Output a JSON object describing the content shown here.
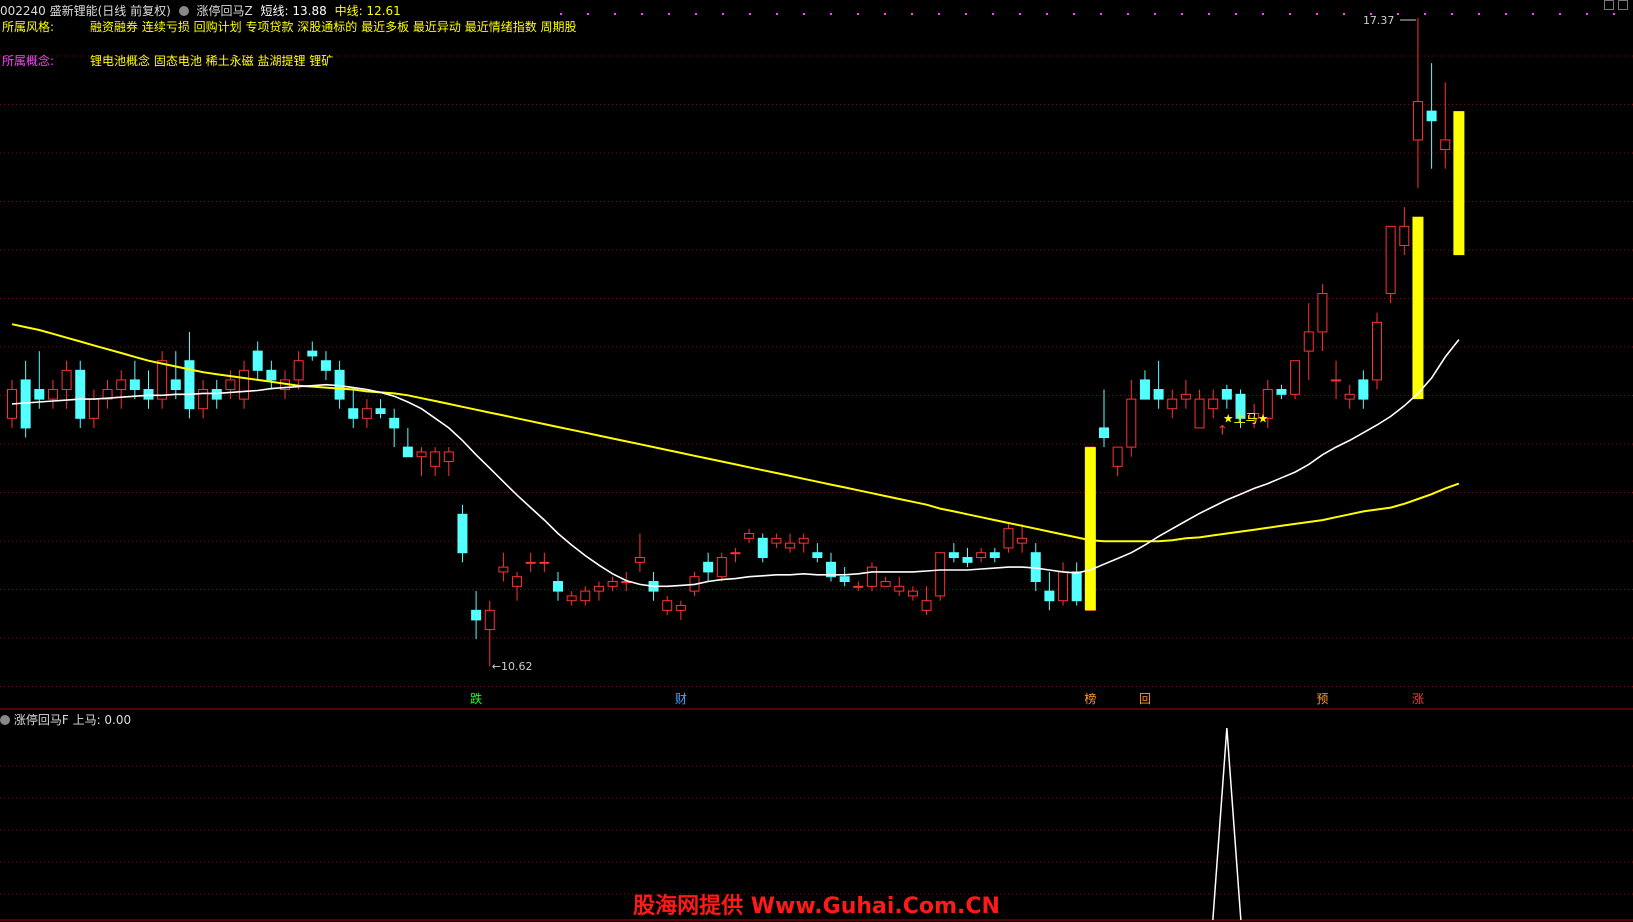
{
  "header": {
    "code_name": "002240 盛新锂能(日线 前复权)",
    "indicator": "涨停回马Z",
    "short_label": "短线: 13.88",
    "mid_label": "中线: 12.61"
  },
  "info": {
    "style_label": "所属风格:",
    "style_value": "融资融券 连续亏损 回购计划 专项贷款 深股通标的 最近多板 最近异动 最近情绪指数 周期股",
    "concept_label": "所属概念:",
    "concept_value": "锂电池概念 固态电池 稀土永磁 盐湖提锂 锂矿"
  },
  "sub_indicator": {
    "name": "涨停回马F",
    "value_label": "上马: 0.00"
  },
  "watermark": "股海网提供 Www.Guhai.Com.CN",
  "colors": {
    "up": "#ff3232",
    "down": "#54ffff",
    "short_line": "#ffffff",
    "mid_line": "#ffff00",
    "signal": "#ffff00",
    "grid": "#8b0000"
  },
  "chart_data": {
    "type": "candlestick",
    "price_min_label": "←10.62",
    "price_max_label": "17.37",
    "ohlc": [
      [
        13.2,
        13.6,
        13.1,
        13.5
      ],
      [
        13.6,
        13.8,
        13.0,
        13.1
      ],
      [
        13.5,
        13.9,
        13.3,
        13.4
      ],
      [
        13.4,
        13.6,
        13.3,
        13.5
      ],
      [
        13.5,
        13.8,
        13.3,
        13.7
      ],
      [
        13.7,
        13.8,
        13.1,
        13.2
      ],
      [
        13.2,
        13.5,
        13.1,
        13.4
      ],
      [
        13.4,
        13.6,
        13.3,
        13.5
      ],
      [
        13.5,
        13.7,
        13.3,
        13.6
      ],
      [
        13.6,
        13.8,
        13.4,
        13.5
      ],
      [
        13.5,
        13.7,
        13.3,
        13.4
      ],
      [
        13.4,
        13.9,
        13.3,
        13.8
      ],
      [
        13.6,
        13.9,
        13.4,
        13.5
      ],
      [
        13.8,
        14.1,
        13.2,
        13.3
      ],
      [
        13.3,
        13.6,
        13.2,
        13.5
      ],
      [
        13.5,
        13.6,
        13.3,
        13.4
      ],
      [
        13.5,
        13.7,
        13.4,
        13.6
      ],
      [
        13.4,
        13.8,
        13.3,
        13.7
      ],
      [
        13.9,
        14.0,
        13.6,
        13.7
      ],
      [
        13.7,
        13.8,
        13.5,
        13.6
      ],
      [
        13.5,
        13.7,
        13.4,
        13.6
      ],
      [
        13.6,
        13.9,
        13.5,
        13.8
      ],
      [
        13.9,
        14.0,
        13.8,
        13.85
      ],
      [
        13.8,
        13.9,
        13.6,
        13.7
      ],
      [
        13.7,
        13.8,
        13.3,
        13.4
      ],
      [
        13.3,
        13.5,
        13.1,
        13.2
      ],
      [
        13.2,
        13.4,
        13.1,
        13.3
      ],
      [
        13.3,
        13.4,
        13.2,
        13.25
      ],
      [
        13.2,
        13.3,
        12.9,
        13.1
      ],
      [
        12.9,
        13.1,
        12.8,
        12.8
      ],
      [
        12.8,
        12.9,
        12.6,
        12.85
      ],
      [
        12.7,
        12.9,
        12.6,
        12.85
      ],
      [
        12.75,
        12.9,
        12.6,
        12.85
      ],
      [
        12.2,
        12.3,
        11.7,
        11.8
      ],
      [
        11.2,
        11.4,
        10.9,
        11.1
      ],
      [
        11.0,
        11.3,
        10.62,
        11.2
      ],
      [
        11.6,
        11.8,
        11.5,
        11.65
      ],
      [
        11.45,
        11.6,
        11.3,
        11.55
      ],
      [
        11.7,
        11.8,
        11.6,
        11.7
      ],
      [
        11.7,
        11.8,
        11.6,
        11.7
      ],
      [
        11.5,
        11.6,
        11.3,
        11.4
      ],
      [
        11.3,
        11.4,
        11.25,
        11.35
      ],
      [
        11.3,
        11.45,
        11.25,
        11.4
      ],
      [
        11.4,
        11.5,
        11.3,
        11.45
      ],
      [
        11.45,
        11.55,
        11.4,
        11.5
      ],
      [
        11.5,
        11.6,
        11.4,
        11.5
      ],
      [
        11.7,
        12.0,
        11.6,
        11.75
      ],
      [
        11.5,
        11.6,
        11.3,
        11.4
      ],
      [
        11.2,
        11.35,
        11.15,
        11.3
      ],
      [
        11.2,
        11.3,
        11.1,
        11.25
      ],
      [
        11.4,
        11.6,
        11.35,
        11.55
      ],
      [
        11.7,
        11.8,
        11.5,
        11.6
      ],
      [
        11.55,
        11.8,
        11.5,
        11.75
      ],
      [
        11.8,
        11.85,
        11.7,
        11.8
      ],
      [
        11.95,
        12.05,
        11.9,
        12.0
      ],
      [
        11.95,
        12.0,
        11.7,
        11.75
      ],
      [
        11.9,
        12.0,
        11.85,
        11.95
      ],
      [
        11.85,
        12.0,
        11.8,
        11.9
      ],
      [
        11.9,
        12.0,
        11.8,
        11.95
      ],
      [
        11.8,
        11.9,
        11.7,
        11.75
      ],
      [
        11.7,
        11.8,
        11.5,
        11.55
      ],
      [
        11.55,
        11.65,
        11.45,
        11.5
      ],
      [
        11.45,
        11.5,
        11.4,
        11.45
      ],
      [
        11.45,
        11.7,
        11.4,
        11.65
      ],
      [
        11.45,
        11.55,
        11.45,
        11.5
      ],
      [
        11.4,
        11.55,
        11.35,
        11.45
      ],
      [
        11.35,
        11.45,
        11.3,
        11.4
      ],
      [
        11.2,
        11.45,
        11.15,
        11.3
      ],
      [
        11.35,
        11.8,
        11.3,
        11.8
      ],
      [
        11.8,
        11.9,
        11.7,
        11.75
      ],
      [
        11.75,
        11.85,
        11.65,
        11.7
      ],
      [
        11.75,
        11.85,
        11.7,
        11.8
      ],
      [
        11.8,
        11.85,
        11.7,
        11.75
      ],
      [
        11.85,
        12.1,
        11.8,
        12.05
      ],
      [
        11.9,
        12.1,
        11.8,
        11.95
      ],
      [
        11.8,
        11.9,
        11.4,
        11.5
      ],
      [
        11.4,
        11.6,
        11.2,
        11.3
      ],
      [
        11.3,
        11.7,
        11.25,
        11.6
      ],
      [
        11.6,
        11.7,
        11.25,
        11.3
      ],
      [
        11.2,
        12.9,
        11.2,
        12.9
      ],
      [
        13.1,
        13.5,
        12.9,
        13.0
      ],
      [
        12.7,
        12.9,
        12.6,
        12.9
      ],
      [
        12.9,
        13.6,
        12.8,
        13.4
      ],
      [
        13.6,
        13.7,
        13.4,
        13.4
      ],
      [
        13.5,
        13.8,
        13.3,
        13.4
      ],
      [
        13.3,
        13.5,
        13.2,
        13.4
      ],
      [
        13.4,
        13.6,
        13.3,
        13.45
      ],
      [
        13.1,
        13.5,
        13.1,
        13.4
      ],
      [
        13.3,
        13.5,
        13.2,
        13.4
      ],
      [
        13.5,
        13.55,
        13.3,
        13.4
      ],
      [
        13.45,
        13.5,
        13.1,
        13.2
      ],
      [
        13.2,
        13.35,
        13.1,
        13.25
      ],
      [
        13.2,
        13.6,
        13.1,
        13.5
      ],
      [
        13.5,
        13.55,
        13.4,
        13.45
      ],
      [
        13.45,
        13.8,
        13.4,
        13.8
      ],
      [
        13.9,
        14.4,
        13.6,
        14.1
      ],
      [
        14.1,
        14.6,
        13.9,
        14.5
      ],
      [
        13.6,
        13.8,
        13.4,
        13.6
      ],
      [
        13.4,
        13.55,
        13.3,
        13.45
      ],
      [
        13.6,
        13.7,
        13.3,
        13.4
      ],
      [
        13.6,
        14.3,
        13.5,
        14.2
      ],
      [
        14.5,
        15.2,
        14.4,
        15.2
      ],
      [
        15.0,
        15.4,
        14.9,
        15.2
      ],
      [
        16.1,
        17.37,
        15.6,
        16.5
      ],
      [
        16.4,
        16.9,
        15.8,
        16.3
      ],
      [
        16.0,
        16.7,
        15.8,
        16.1
      ]
    ],
    "short_ma": [
      13.35,
      13.36,
      13.37,
      13.38,
      13.39,
      13.4,
      13.4,
      13.41,
      13.42,
      13.43,
      13.44,
      13.44,
      13.45,
      13.45,
      13.46,
      13.46,
      13.47,
      13.48,
      13.49,
      13.51,
      13.52,
      13.53,
      13.54,
      13.55,
      13.54,
      13.52,
      13.5,
      13.47,
      13.43,
      13.37,
      13.3,
      13.2,
      13.1,
      12.97,
      12.82,
      12.68,
      12.54,
      12.4,
      12.27,
      12.14,
      12.0,
      11.88,
      11.77,
      11.67,
      11.58,
      11.51,
      11.47,
      11.45,
      11.45,
      11.46,
      11.47,
      11.5,
      11.52,
      11.53,
      11.55,
      11.56,
      11.57,
      11.57,
      11.58,
      11.57,
      11.57,
      11.57,
      11.58,
      11.6,
      11.6,
      11.6,
      11.6,
      11.61,
      11.62,
      11.62,
      11.62,
      11.63,
      11.64,
      11.65,
      11.65,
      11.64,
      11.62,
      11.6,
      11.59,
      11.62,
      11.68,
      11.74,
      11.8,
      11.88,
      11.97,
      12.05,
      12.13,
      12.21,
      12.28,
      12.35,
      12.41,
      12.47,
      12.52,
      12.58,
      12.64,
      12.72,
      12.82,
      12.9,
      12.97,
      13.05,
      13.13,
      13.22,
      13.33,
      13.46,
      13.62,
      13.84,
      14.02
    ],
    "mid_ma": [
      14.18,
      14.15,
      14.12,
      14.08,
      14.04,
      14.0,
      13.96,
      13.92,
      13.88,
      13.84,
      13.8,
      13.77,
      13.74,
      13.71,
      13.68,
      13.66,
      13.64,
      13.62,
      13.6,
      13.58,
      13.56,
      13.54,
      13.53,
      13.52,
      13.51,
      13.5,
      13.48,
      13.47,
      13.46,
      13.44,
      13.41,
      13.38,
      13.35,
      13.32,
      13.29,
      13.26,
      13.23,
      13.2,
      13.17,
      13.14,
      13.11,
      13.08,
      13.05,
      13.02,
      12.99,
      12.96,
      12.93,
      12.9,
      12.87,
      12.84,
      12.81,
      12.78,
      12.75,
      12.72,
      12.69,
      12.66,
      12.63,
      12.6,
      12.57,
      12.54,
      12.51,
      12.48,
      12.45,
      12.42,
      12.39,
      12.36,
      12.33,
      12.3,
      12.26,
      12.23,
      12.2,
      12.17,
      12.14,
      12.11,
      12.08,
      12.05,
      12.02,
      11.99,
      11.96,
      11.93,
      11.92,
      11.92,
      11.92,
      11.92,
      11.92,
      11.93,
      11.95,
      11.96,
      11.98,
      12.0,
      12.02,
      12.04,
      12.06,
      12.08,
      12.1,
      12.12,
      12.14,
      12.17,
      12.2,
      12.23,
      12.25,
      12.27,
      12.31,
      12.36,
      12.41,
      12.47,
      12.52
    ],
    "signal_bars": [
      {
        "index": 79,
        "low": 11.2,
        "high": 12.9
      },
      {
        "index": 103,
        "low": 13.4,
        "high": 15.3
      },
      {
        "index": 106,
        "low": 14.9,
        "high": 16.4
      }
    ],
    "bottom_markers": [
      {
        "index": 34,
        "text": "跌",
        "color": "#22ff22"
      },
      {
        "index": 49,
        "text": "财",
        "color": "#4aa8ff"
      },
      {
        "index": 79,
        "text": "榜",
        "color": "#ff9933"
      },
      {
        "index": 83,
        "text": "回",
        "color": "#ff9933"
      },
      {
        "index": 96,
        "text": "预",
        "color": "#ff9933"
      },
      {
        "index": 103,
        "text": "涨",
        "color": "#ff3333"
      }
    ],
    "entry_marker": {
      "index": 89,
      "text": "★上马★"
    },
    "sub_peak_index": 89
  }
}
